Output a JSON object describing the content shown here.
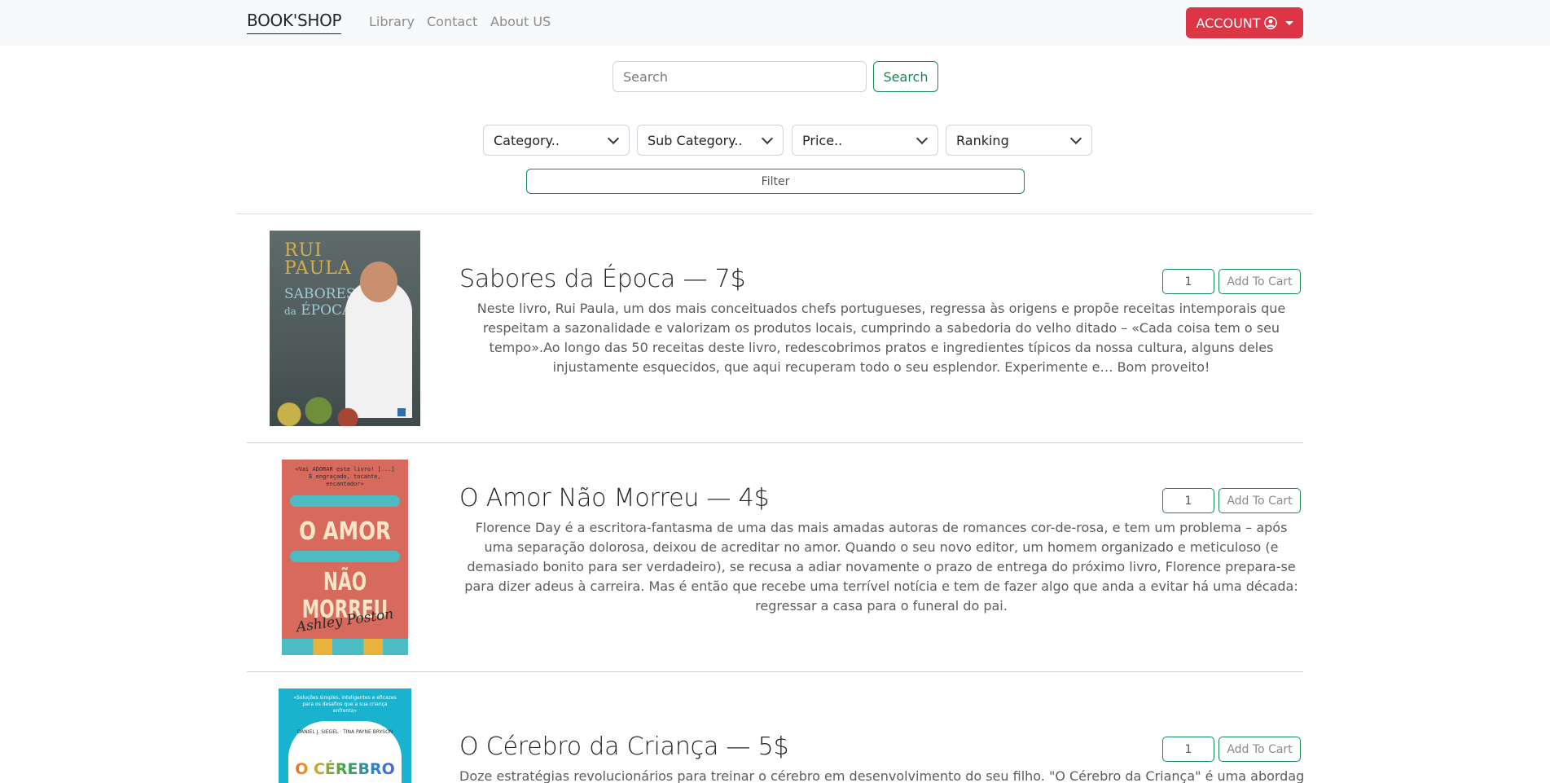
{
  "nav": {
    "brand": "BOOK'SHOP",
    "links": [
      "Library",
      "Contact",
      "About US"
    ],
    "account_label": "ACCOUNT"
  },
  "search": {
    "placeholder": "Search",
    "button_label": "Search"
  },
  "filters": {
    "selects": [
      "Category..",
      "Sub Category..",
      "Price..",
      "Ranking"
    ],
    "button_label": "Filter"
  },
  "books": [
    {
      "title": "Sabores da Época — 7$",
      "description": "Neste livro, Rui Paula, um dos mais conceituados chefs portugueses, regressa às origens e propõe receitas intemporais que respeitam a sazonalidade e valorizam os produtos locais, cumprindo a sabedoria do velho ditado – «Cada coisa tem o seu tempo».Ao longo das 50 receitas deste livro, redescobrimos pratos e ingredientes típicos da nossa cultura, alguns deles injustamente esquecidos, que aqui recuperam todo o seu esplendor. Experimente e… Bom proveito!",
      "quantity": "1",
      "cart_label": "Add To Cart",
      "cover": {
        "author": "RUI PAULA",
        "title": "SABORES",
        "title2": "da ÉPOCA"
      }
    },
    {
      "title": "O Amor Não Morreu — 4$",
      "description": "Florence Day é a escritora-fantasma de uma das mais amadas autoras de romances cor-de-rosa, e tem um problema – após uma separação dolorosa, deixou de acreditar no amor. Quando o seu novo editor, um homem organizado e meticuloso (e demasiado bonito para ser verdadeiro), se recusa a adiar novamente o prazo de entrega do próximo livro, Florence prepara-se para dizer adeus à carreira. Mas é então que recebe uma terrível notícia e tem de fazer algo que anda a evitar há uma década: regressar a casa para o funeral do pai.",
      "quantity": "1",
      "cart_label": "Add To Cart",
      "cover": {
        "line1": "O AMOR",
        "line2": "NÃO MORREU",
        "author": "Ashley Poston"
      }
    },
    {
      "title": "O Cérebro da Criança — 5$",
      "description": "Doze estratégias revolucionários para treinar o cérebro em desenvolvimento do seu filho. \"O Cérebro da Criança\" é uma abordagem",
      "quantity": "1",
      "cart_label": "Add To Cart",
      "cover": {
        "authors": "DANIEL J. SIEGEL · TINA PAYNE BRYSON",
        "title": "O CÉREBRO"
      }
    }
  ],
  "colors": {
    "accent_danger": "#dc3545",
    "accent_success": "#198754"
  }
}
